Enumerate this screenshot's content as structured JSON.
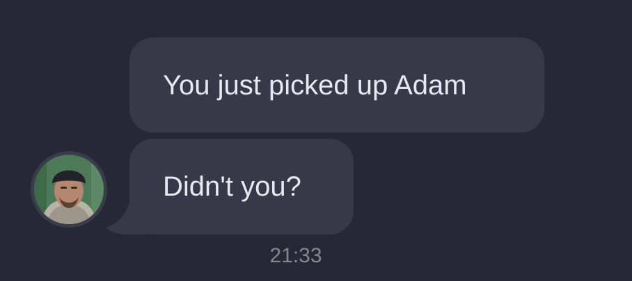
{
  "messages": [
    {
      "text": "You just picked up Adam"
    },
    {
      "text": "Didn't you?"
    }
  ],
  "timestamp": "21:33",
  "avatar": {
    "icon": "person-avatar-icon"
  },
  "colors": {
    "background": "#272835",
    "bubble": "#373949",
    "text": "#e8e9ef",
    "timestamp": "#85868f"
  }
}
